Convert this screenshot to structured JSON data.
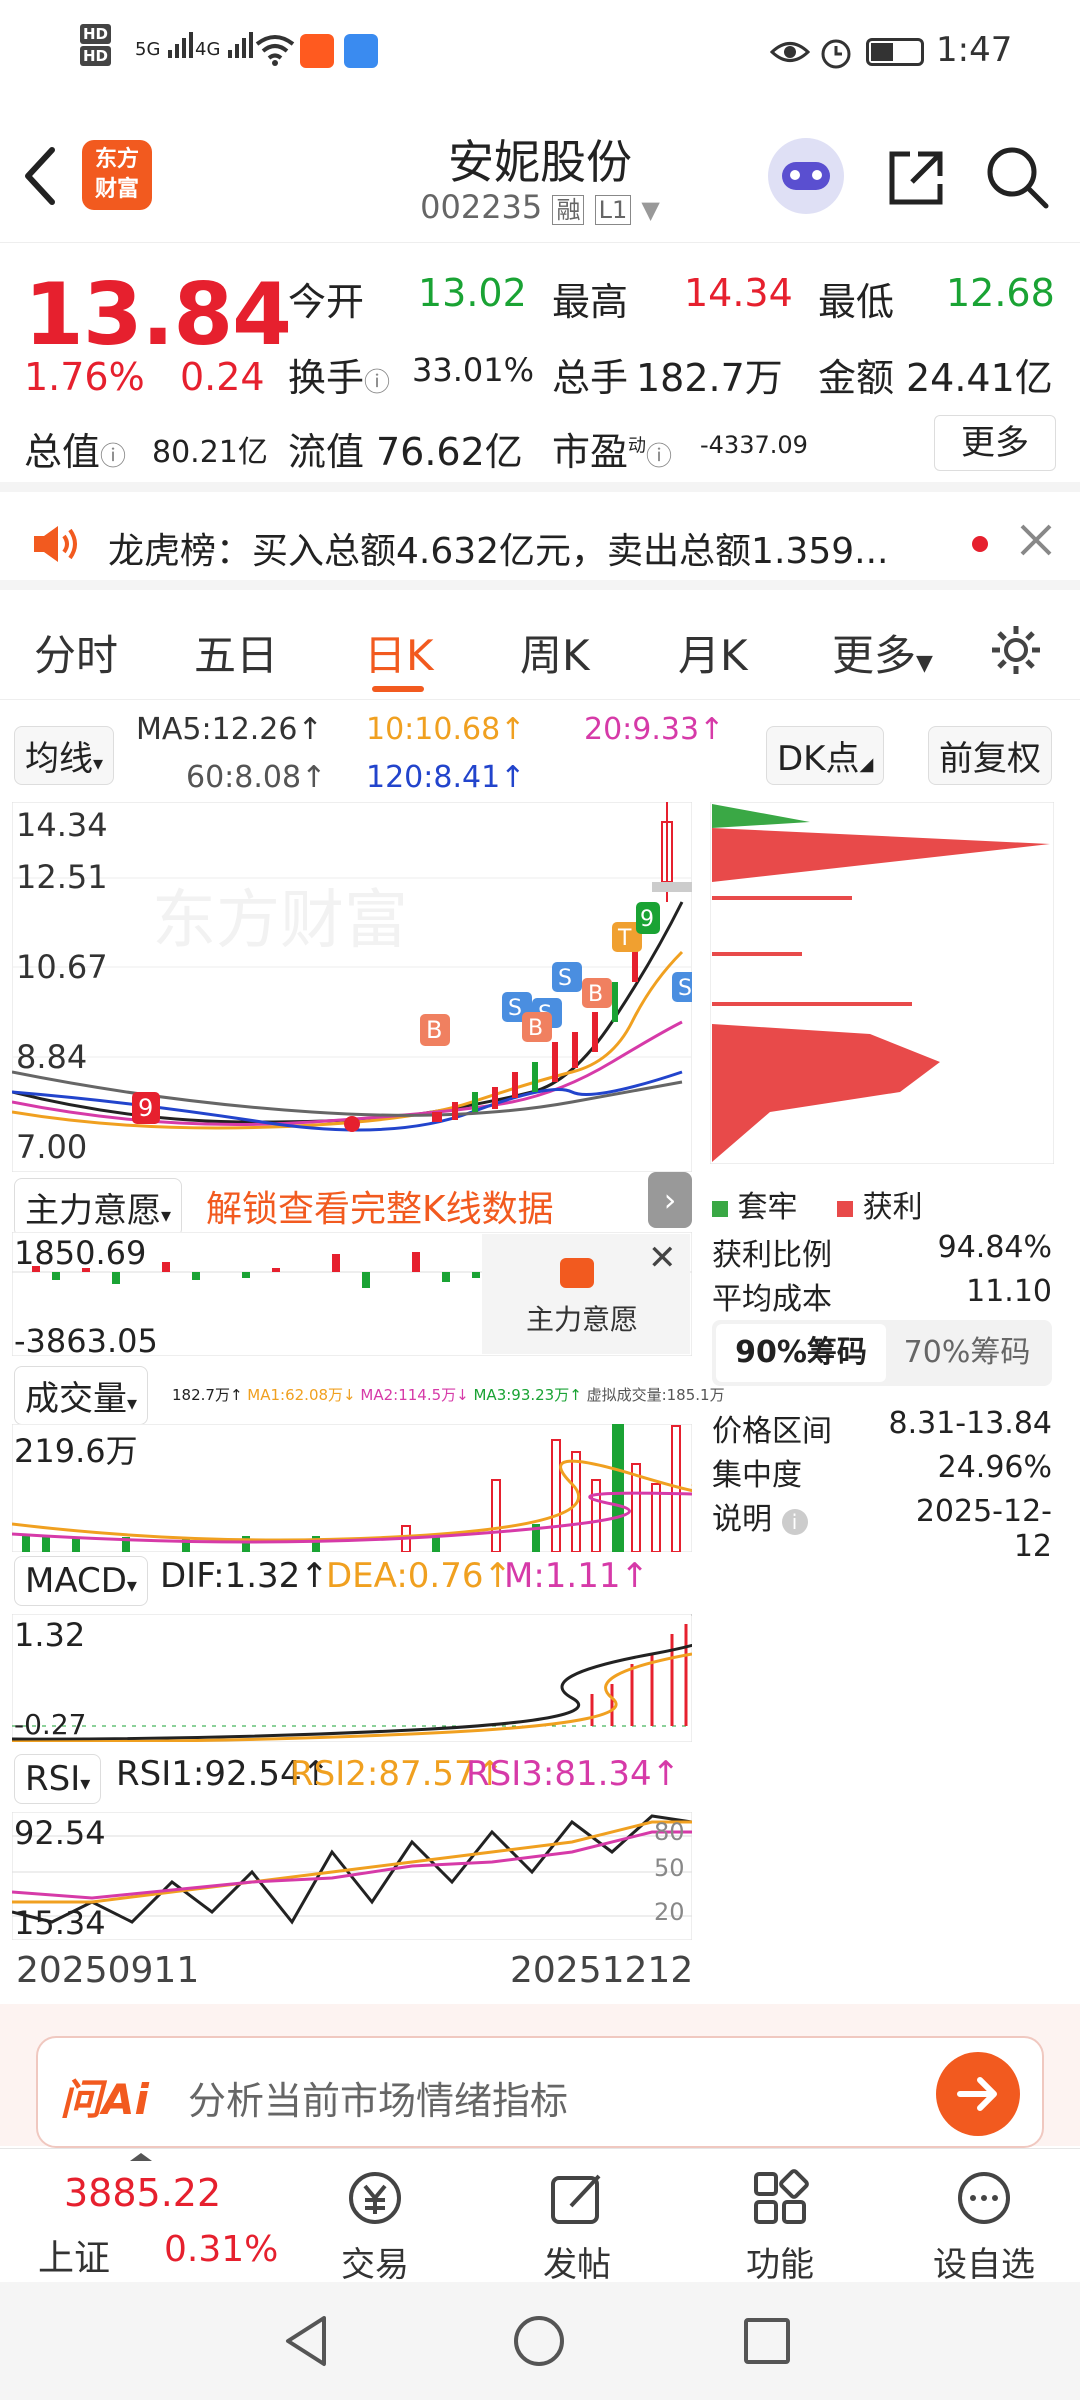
{
  "status": {
    "hd1": "HD",
    "hd2": "HD",
    "sig1": "5G",
    "sig2": "4G",
    "time": "1:47"
  },
  "header": {
    "back_icon": "back-arrow-icon",
    "logo_line1": "东方",
    "logo_line2": "财富",
    "title": "安妮股份",
    "code": "002235",
    "badge_rong": "融",
    "badge_level": "L1"
  },
  "quote": {
    "price": "13.84",
    "change_pct": "1.76%",
    "change_amt": "0.24",
    "open_label": "今开",
    "open": "13.02",
    "high_label": "最高",
    "high": "14.34",
    "low_label": "最低",
    "low": "12.68",
    "turnover_label": "换手",
    "turnover": "33.01%",
    "volume_label": "总手",
    "volume": "182.7万",
    "amount_label": "金额",
    "amount": "24.41亿",
    "mktcap_label": "总值",
    "mktcap": "80.21亿",
    "float_label": "流值",
    "float": "76.62亿",
    "pe_label": "市盈",
    "pe_sup": "动",
    "pe": "-4337.09",
    "more_label": "更多"
  },
  "notice": {
    "text": "龙虎榜：买入总额4.632亿元，卖出总额1.359..."
  },
  "tabs": {
    "items": [
      "分时",
      "五日",
      "日K",
      "周K",
      "月K",
      "更多"
    ]
  },
  "ma": {
    "toggle": "均线",
    "ma5": "MA5:12.26↑",
    "ma10": "10:10.68↑",
    "ma20": "20:9.33↑",
    "ma60": "60:8.08↑",
    "ma120": "120:8.41↑",
    "dk": "DK点",
    "fq": "前复权"
  },
  "kline": {
    "y_labels": [
      "14.34",
      "12.51",
      "10.67",
      "8.84",
      "7.00"
    ],
    "watermark": "东方财富"
  },
  "indicator1": {
    "name": "主力意愿",
    "unlock": "解锁查看完整K线数据",
    "max": "1850.69",
    "min": "-3863.05",
    "popup": "主力意愿"
  },
  "indicator2": {
    "name": "成交量",
    "info_vol": "182.7万↑",
    "info_ma1": "MA1:62.08万↓",
    "info_ma2": "MA2:114.5万↓",
    "info_ma3": "MA3:93.23万↑",
    "info_virtual": "虚拟成交量:185.1万",
    "max": "219.6万"
  },
  "indicator3": {
    "name": "MACD",
    "dif": "DIF:1.32↑",
    "dea": "DEA:0.76↑",
    "m": "M:1.11↑",
    "max": "1.32",
    "min": "-0.27"
  },
  "indicator4": {
    "name": "RSI",
    "rsi1": "RSI1:92.54↑",
    "rsi2": "RSI2:87.57↑",
    "rsi3": "RSI3:81.34↑",
    "max": "92.54",
    "min": "15.34",
    "r80": "80",
    "r50": "50",
    "r20": "20"
  },
  "dates": {
    "start": "20250911",
    "end": "20251212"
  },
  "chips": {
    "legend_trap": "套牢",
    "legend_profit": "获利",
    "profit_ratio_label": "获利比例",
    "profit_ratio": "94.84%",
    "avg_cost_label": "平均成本",
    "avg_cost": "11.10",
    "tab90": "90%筹码",
    "tab70": "70%筹码",
    "range_label": "价格区间",
    "range": "8.31-13.84",
    "conc_label": "集中度",
    "conc": "24.96%",
    "note_label": "说明",
    "note_date": "2025-12-12"
  },
  "askai": {
    "brand": "问Ai",
    "placeholder": "分析当前市场情绪指标"
  },
  "bottomnav": {
    "index_value": "3885.22",
    "index_name": "上证",
    "index_pct": "0.31%",
    "trade": "交易",
    "post": "发帖",
    "func": "功能",
    "fav": "设自选"
  },
  "colors": {
    "red": "#e6202e",
    "green": "#1aa334",
    "orange": "#ff6a00",
    "ma10": "#f0a020",
    "ma20": "#d63aa8",
    "ma120": "#2244cc"
  }
}
